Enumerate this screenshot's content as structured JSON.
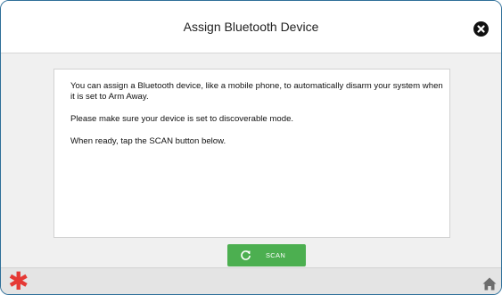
{
  "header": {
    "title": "Assign Bluetooth Device",
    "close_icon": "close-circle-icon"
  },
  "message": {
    "paragraph1": "You can assign a Bluetooth device, like a mobile phone, to automatically disarm your system when it is set to Arm Away.",
    "paragraph2": "Please make sure your device is set to discoverable mode.",
    "paragraph3": "When ready, tap the SCAN button below."
  },
  "actions": {
    "scan_label": "SCAN",
    "scan_icon": "refresh-icon"
  },
  "footer": {
    "left_icon": "asterisk-icon",
    "right_icon": "home-icon"
  },
  "colors": {
    "frame_border": "#2e6f99",
    "scan_button": "#4caf50",
    "asterisk": "#e53935"
  }
}
